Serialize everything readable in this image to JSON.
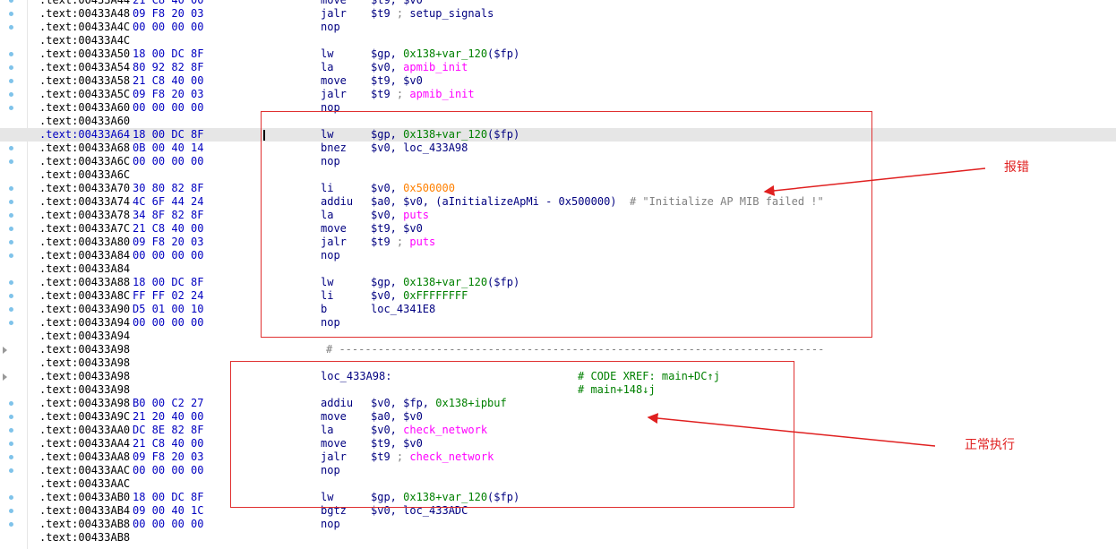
{
  "listing": [
    {
      "seg": ".text",
      "off": "00433A44",
      "bytes": "21 C8 40 00",
      "mn": "move",
      "ops": [
        {
          "t": "$t9, $v0",
          "c": "reg"
        }
      ]
    },
    {
      "seg": ".text",
      "off": "00433A48",
      "bytes": "09 F8 20 03",
      "mn": "jalr",
      "ops": [
        {
          "t": "$t9",
          "c": "reg"
        },
        {
          "t": " ; ",
          "c": "cmt"
        },
        {
          "t": "setup_signals",
          "c": "reg"
        }
      ]
    },
    {
      "seg": ".text",
      "off": "00433A4C",
      "bytes": "00 00 00 00",
      "mn": "nop",
      "ops": []
    },
    {
      "seg": ".text",
      "off": "00433A4C",
      "bytes": "",
      "mn": "",
      "ops": []
    },
    {
      "seg": ".text",
      "off": "00433A50",
      "bytes": "18 00 DC 8F",
      "mn": "lw",
      "ops": [
        {
          "t": "$gp, ",
          "c": "reg"
        },
        {
          "t": "0x138+var_120",
          "c": "num"
        },
        {
          "t": "($fp)",
          "c": "reg"
        }
      ]
    },
    {
      "seg": ".text",
      "off": "00433A54",
      "bytes": "80 92 82 8F",
      "mn": "la",
      "ops": [
        {
          "t": "$v0, ",
          "c": "reg"
        },
        {
          "t": "apmib_init",
          "c": "fn"
        }
      ]
    },
    {
      "seg": ".text",
      "off": "00433A58",
      "bytes": "21 C8 40 00",
      "mn": "move",
      "ops": [
        {
          "t": "$t9, $v0",
          "c": "reg"
        }
      ]
    },
    {
      "seg": ".text",
      "off": "00433A5C",
      "bytes": "09 F8 20 03",
      "mn": "jalr",
      "ops": [
        {
          "t": "$t9",
          "c": "reg"
        },
        {
          "t": " ; ",
          "c": "cmt"
        },
        {
          "t": "apmib_init",
          "c": "fn"
        }
      ]
    },
    {
      "seg": ".text",
      "off": "00433A60",
      "bytes": "00 00 00 00",
      "mn": "nop",
      "ops": []
    },
    {
      "seg": ".text",
      "off": "00433A60",
      "bytes": "",
      "mn": "",
      "ops": []
    },
    {
      "seg": ".text",
      "off": "00433A64",
      "bytes": "18 00 DC 8F",
      "mn": "lw",
      "ops": [
        {
          "t": "$gp, ",
          "c": "reg"
        },
        {
          "t": "0x138+var_120",
          "c": "num"
        },
        {
          "t": "($fp)",
          "c": "reg"
        }
      ],
      "highlight": true
    },
    {
      "seg": ".text",
      "off": "00433A68",
      "bytes": "0B 00 40 14",
      "mn": "bnez",
      "ops": [
        {
          "t": "$v0, loc_433A98",
          "c": "reg"
        }
      ]
    },
    {
      "seg": ".text",
      "off": "00433A6C",
      "bytes": "00 00 00 00",
      "mn": "nop",
      "ops": []
    },
    {
      "seg": ".text",
      "off": "00433A6C",
      "bytes": "",
      "mn": "",
      "ops": []
    },
    {
      "seg": ".text",
      "off": "00433A70",
      "bytes": "30 80 82 8F",
      "mn": "li",
      "ops": [
        {
          "t": "$v0, ",
          "c": "reg"
        },
        {
          "t": "0x500000",
          "c": "imm"
        }
      ]
    },
    {
      "seg": ".text",
      "off": "00433A74",
      "bytes": "4C 6F 44 24",
      "mn": "addiu",
      "ops": [
        {
          "t": "$a0, $v0, (aInitializeApMi - 0x500000)  ",
          "c": "reg"
        },
        {
          "t": "# \"Initialize AP MIB failed !\"",
          "c": "cmt"
        }
      ]
    },
    {
      "seg": ".text",
      "off": "00433A78",
      "bytes": "34 8F 82 8F",
      "mn": "la",
      "ops": [
        {
          "t": "$v0, ",
          "c": "reg"
        },
        {
          "t": "puts",
          "c": "fn"
        }
      ]
    },
    {
      "seg": ".text",
      "off": "00433A7C",
      "bytes": "21 C8 40 00",
      "mn": "move",
      "ops": [
        {
          "t": "$t9, $v0",
          "c": "reg"
        }
      ]
    },
    {
      "seg": ".text",
      "off": "00433A80",
      "bytes": "09 F8 20 03",
      "mn": "jalr",
      "ops": [
        {
          "t": "$t9",
          "c": "reg"
        },
        {
          "t": " ; ",
          "c": "cmt"
        },
        {
          "t": "puts",
          "c": "fn"
        }
      ]
    },
    {
      "seg": ".text",
      "off": "00433A84",
      "bytes": "00 00 00 00",
      "mn": "nop",
      "ops": []
    },
    {
      "seg": ".text",
      "off": "00433A84",
      "bytes": "",
      "mn": "",
      "ops": []
    },
    {
      "seg": ".text",
      "off": "00433A88",
      "bytes": "18 00 DC 8F",
      "mn": "lw",
      "ops": [
        {
          "t": "$gp, ",
          "c": "reg"
        },
        {
          "t": "0x138+var_120",
          "c": "num"
        },
        {
          "t": "($fp)",
          "c": "reg"
        }
      ]
    },
    {
      "seg": ".text",
      "off": "00433A8C",
      "bytes": "FF FF 02 24",
      "mn": "li",
      "ops": [
        {
          "t": "$v0, ",
          "c": "reg"
        },
        {
          "t": "0xFFFFFFFF",
          "c": "num"
        }
      ]
    },
    {
      "seg": ".text",
      "off": "00433A90",
      "bytes": "D5 01 00 10",
      "mn": "b",
      "ops": [
        {
          "t": "loc_4341E8",
          "c": "reg"
        }
      ]
    },
    {
      "seg": ".text",
      "off": "00433A94",
      "bytes": "00 00 00 00",
      "mn": "nop",
      "ops": []
    },
    {
      "seg": ".text",
      "off": "00433A94",
      "bytes": "",
      "mn": "",
      "ops": []
    },
    {
      "seg": ".text",
      "off": "00433A98",
      "bytes": "",
      "mn": "",
      "ops": [],
      "sep": "# ---------------------------------------------------------------------------"
    },
    {
      "seg": ".text",
      "off": "00433A98",
      "bytes": "",
      "mn": "",
      "ops": []
    },
    {
      "seg": ".text",
      "off": "00433A98",
      "bytes": "",
      "mn": "",
      "ops": [],
      "label": "loc_433A98:",
      "xref": "# CODE XREF: main+DC↑j"
    },
    {
      "seg": ".text",
      "off": "00433A98",
      "bytes": "",
      "mn": "",
      "ops": [],
      "xref": "# main+148↓j"
    },
    {
      "seg": ".text",
      "off": "00433A98",
      "bytes": "B0 00 C2 27",
      "mn": "addiu",
      "ops": [
        {
          "t": "$v0, $fp, ",
          "c": "reg"
        },
        {
          "t": "0x138+ipbuf",
          "c": "num"
        }
      ]
    },
    {
      "seg": ".text",
      "off": "00433A9C",
      "bytes": "21 20 40 00",
      "mn": "move",
      "ops": [
        {
          "t": "$a0, $v0",
          "c": "reg"
        }
      ]
    },
    {
      "seg": ".text",
      "off": "00433AA0",
      "bytes": "DC 8E 82 8F",
      "mn": "la",
      "ops": [
        {
          "t": "$v0, ",
          "c": "reg"
        },
        {
          "t": "check_network",
          "c": "fn"
        }
      ]
    },
    {
      "seg": ".text",
      "off": "00433AA4",
      "bytes": "21 C8 40 00",
      "mn": "move",
      "ops": [
        {
          "t": "$t9, $v0",
          "c": "reg"
        }
      ]
    },
    {
      "seg": ".text",
      "off": "00433AA8",
      "bytes": "09 F8 20 03",
      "mn": "jalr",
      "ops": [
        {
          "t": "$t9",
          "c": "reg"
        },
        {
          "t": " ; ",
          "c": "cmt"
        },
        {
          "t": "check_network",
          "c": "fn"
        }
      ]
    },
    {
      "seg": ".text",
      "off": "00433AAC",
      "bytes": "00 00 00 00",
      "mn": "nop",
      "ops": []
    },
    {
      "seg": ".text",
      "off": "00433AAC",
      "bytes": "",
      "mn": "",
      "ops": []
    },
    {
      "seg": ".text",
      "off": "00433AB0",
      "bytes": "18 00 DC 8F",
      "mn": "lw",
      "ops": [
        {
          "t": "$gp, ",
          "c": "reg"
        },
        {
          "t": "0x138+var_120",
          "c": "num"
        },
        {
          "t": "($fp)",
          "c": "reg"
        }
      ]
    },
    {
      "seg": ".text",
      "off": "00433AB4",
      "bytes": "09 00 40 1C",
      "mn": "bgtz",
      "ops": [
        {
          "t": "$v0, loc_433ADC",
          "c": "reg"
        }
      ]
    },
    {
      "seg": ".text",
      "off": "00433AB8",
      "bytes": "00 00 00 00",
      "mn": "nop",
      "ops": []
    },
    {
      "seg": ".text",
      "off": "00433AB8",
      "bytes": "",
      "mn": "",
      "ops": []
    }
  ],
  "annotations": {
    "error_label": "报错",
    "normal_label": "正常执行"
  },
  "colors": {
    "highlight_row": "#e6e6e6",
    "annotation_red": "#e02020",
    "address_blue": "#0000c0",
    "function_magenta": "#ff00ff",
    "immediate_orange": "#ff8000",
    "comment_green": "#008000"
  }
}
